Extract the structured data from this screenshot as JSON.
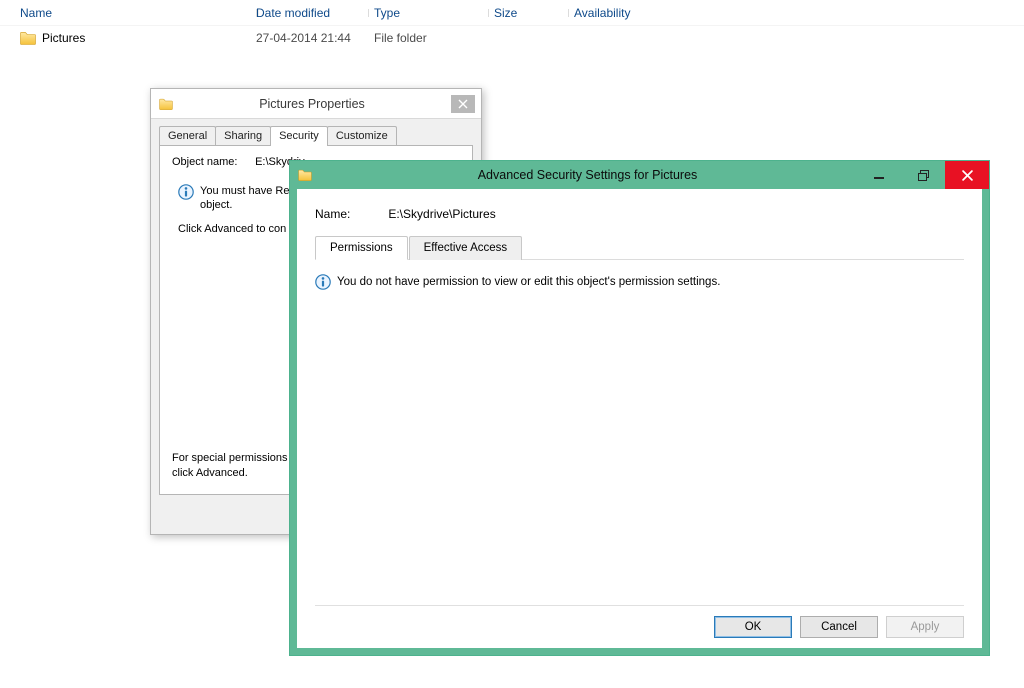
{
  "explorer": {
    "headers": {
      "name": "Name",
      "date": "Date modified",
      "type": "Type",
      "size": "Size",
      "availability": "Availability"
    },
    "row": {
      "name": "Pictures",
      "date": "27-04-2014 21:44",
      "type": "File folder",
      "size": "",
      "availability": ""
    }
  },
  "properties": {
    "title": "Pictures Properties",
    "tabs": {
      "general": "General",
      "sharing": "Sharing",
      "security": "Security",
      "customize": "Customize"
    },
    "object_label": "Object name:",
    "object_value": "E:\\Skydriv",
    "perm_warning_1": "You must have Read p",
    "perm_warning_2": "object.",
    "advanced_hint": "Click Advanced to con",
    "special_1": "For special permissions or a",
    "special_2": "click Advanced."
  },
  "advanced": {
    "title": "Advanced Security Settings for Pictures",
    "name_label": "Name:",
    "name_value": "E:\\Skydrive\\Pictures",
    "tabs": {
      "permissions": "Permissions",
      "effective": "Effective Access"
    },
    "message": "You do not have permission to view or edit this object's permission settings.",
    "buttons": {
      "ok": "OK",
      "cancel": "Cancel",
      "apply": "Apply"
    }
  }
}
